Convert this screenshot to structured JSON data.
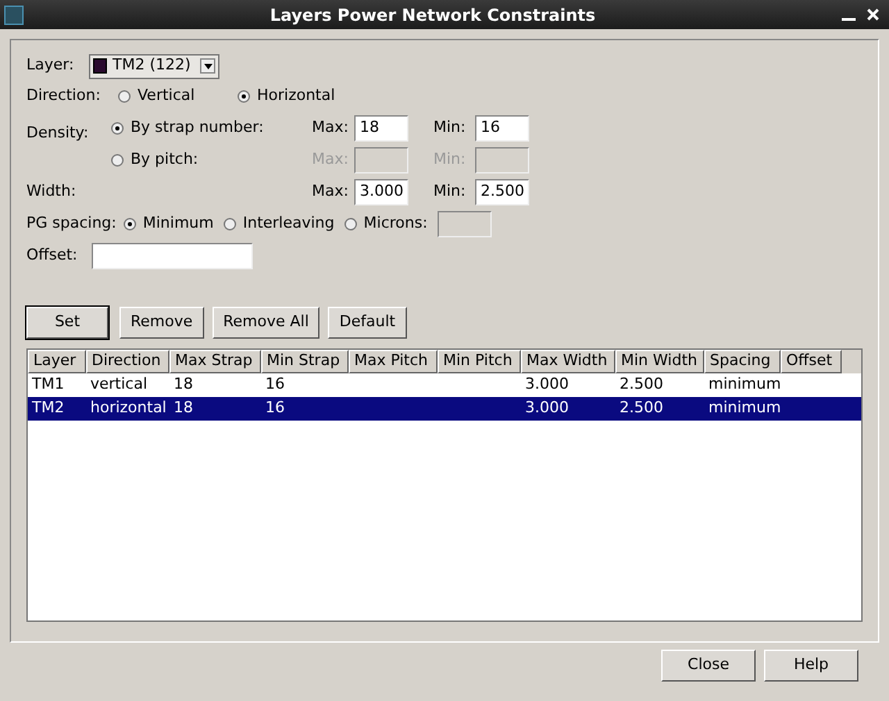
{
  "window": {
    "title": "Layers Power Network Constraints"
  },
  "layer": {
    "label": "Layer:",
    "value": "TM2 (122)",
    "color": "#2a0a2e"
  },
  "direction": {
    "label": "Direction:",
    "options": [
      {
        "label": "Vertical",
        "selected": false
      },
      {
        "label": "Horizontal",
        "selected": true
      }
    ]
  },
  "density": {
    "label": "Density:",
    "options": [
      {
        "label": "By strap number:",
        "selected": true,
        "max_label": "Max:",
        "max": "18",
        "min_label": "Min:",
        "min": "16",
        "disabled": false
      },
      {
        "label": "By pitch:",
        "selected": false,
        "max_label": "Max:",
        "min_label": "Min:",
        "disabled": true
      }
    ]
  },
  "width": {
    "label": "Width:",
    "max_label": "Max:",
    "max": "3.000",
    "min_label": "Min:",
    "min": "2.500"
  },
  "pg_spacing": {
    "label": "PG spacing:",
    "options": [
      {
        "label": "Minimum",
        "selected": true
      },
      {
        "label": "Interleaving",
        "selected": false
      },
      {
        "label": "Microns:",
        "selected": false
      }
    ]
  },
  "offset": {
    "label": "Offset:"
  },
  "buttons": [
    {
      "label": "Set",
      "default": true
    },
    {
      "label": "Remove",
      "default": false
    },
    {
      "label": "Remove All",
      "default": false
    },
    {
      "label": "Default",
      "default": false
    }
  ],
  "table": {
    "columns": [
      "Layer",
      "Direction",
      "Max Strap",
      "Min Strap",
      "Max Pitch",
      "Min Pitch",
      "Max Width",
      "Min Width",
      "Spacing",
      "Offset"
    ],
    "rows": [
      {
        "cells": [
          "TM1",
          "vertical",
          "18",
          "16",
          null,
          null,
          "3.000",
          "2.500",
          "minimum",
          null
        ],
        "selected": false
      },
      {
        "cells": [
          "TM2",
          "horizontal",
          "18",
          "16",
          null,
          null,
          "3.000",
          "2.500",
          "minimum",
          null
        ],
        "selected": true
      }
    ]
  },
  "footer_buttons": [
    {
      "label": "Close"
    },
    {
      "label": "Help"
    }
  ]
}
